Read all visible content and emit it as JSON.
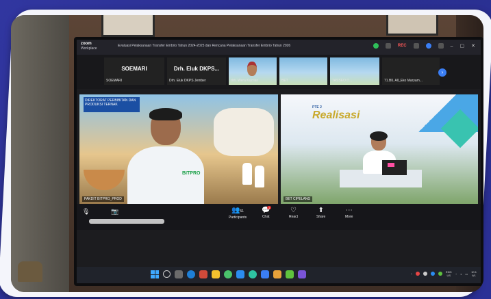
{
  "zoom": {
    "brand": "zoom",
    "product": "Workplace",
    "meeting_title": "Evaluasi Pelaksanaan Transfer Embrio Tahun 2024-2025 dan Rencana Pelaksanaan Transfer Embrio Tahun 2026",
    "rec_label": "REC"
  },
  "participants_strip": [
    {
      "big": "SOEMARI",
      "name": "SOEMARI"
    },
    {
      "big": "Drh. Eluk DKPS...",
      "name": "Drh. Eluk DKPS Jember"
    },
    {
      "big": "",
      "name": "drh. Wera Kuzrian"
    },
    {
      "big": "",
      "name": "BET"
    },
    {
      "big": "",
      "name": "TASSEO D..."
    },
    {
      "big": "",
      "name": "71.BIL All_Eko Maryam..."
    }
  ],
  "video1": {
    "sign_text": "DIREKTORAT PERBIBITAN DAN PRODUKSI TERNAK",
    "shirt_logo": "BITPRO",
    "name_label": "PAKDIT BITPRO_PROD"
  },
  "video2": {
    "event_title": "Realisasi",
    "event_sub": "PTE 2",
    "name_label": "BET CIPELANG"
  },
  "toolbar": {
    "participants_label": "Participants",
    "participants_count": "51",
    "chat_label": "Chat",
    "chat_badge": "1",
    "react_label": "React",
    "share_label": "Share",
    "more_label": "More"
  },
  "taskbar": {
    "lang_top": "ENG",
    "lang_bottom": "US",
    "clock": "10:1",
    "date": "6/1"
  },
  "colors": {
    "background": "#2a2f8f",
    "frame": "#f4f5fb",
    "accent_blue": "#3a7ef5",
    "rec_red": "#ff5959"
  }
}
